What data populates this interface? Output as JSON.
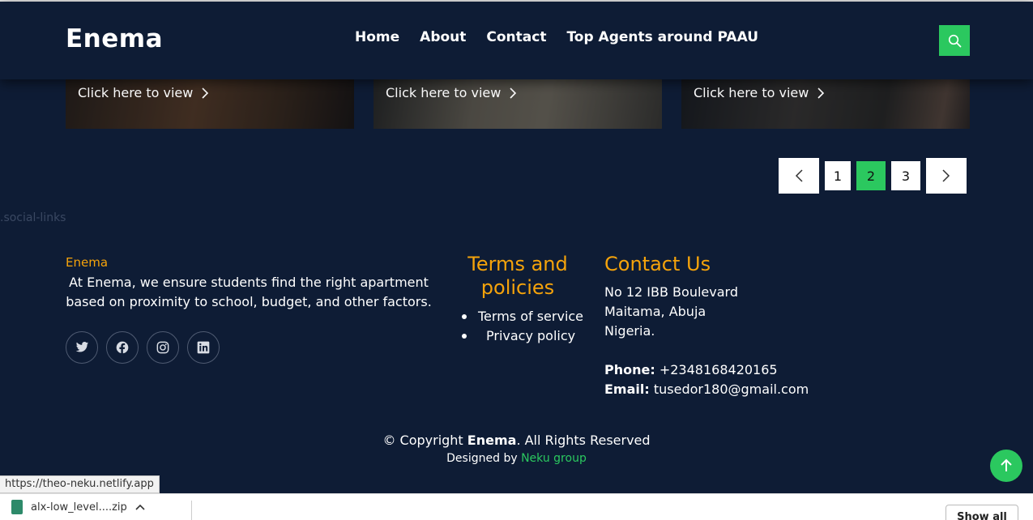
{
  "header": {
    "logo": "Enema",
    "nav": [
      "Home",
      "About",
      "Contact",
      "Top Agents around PAAU"
    ],
    "search_icon": "search-icon"
  },
  "cards": [
    {
      "cta": "Click here to view"
    },
    {
      "cta": "Click here to view"
    },
    {
      "cta": "Click here to view"
    }
  ],
  "pagination": {
    "pages": [
      "1",
      "2",
      "3"
    ],
    "active": "2"
  },
  "ghost_text": ".social-links",
  "footer": {
    "about_title": "Enema",
    "about_text": "At Enema, we ensure students find the right apartment based on proximity to school, budget, and other factors.",
    "socials": [
      "twitter-icon",
      "facebook-icon",
      "instagram-icon",
      "linkedin-icon"
    ],
    "terms_title": "Terms and policies",
    "terms_links": [
      "Terms of service",
      "Privacy policy"
    ],
    "contact_title": "Contact Us",
    "address": [
      "No 12 IBB Boulevard",
      "Maitama, Abuja",
      "Nigeria."
    ],
    "phone_label": "Phone:",
    "phone": "+2348168420165",
    "email_label": "Email:",
    "email": "tusedor180@gmail.com",
    "copyright_prefix": "© Copyright ",
    "copyright_brand": "Enema",
    "copyright_suffix": ". All Rights Reserved",
    "designed_by": "Designed by ",
    "designer": "Neku group"
  },
  "browser": {
    "status_url": "https://theo-neku.netlify.app",
    "download_name": "alx-low_level....zip",
    "show_all": "Show all"
  },
  "colors": {
    "accent": "#2bc85f",
    "heading": "#f5a30b",
    "background": "#0e1c35"
  }
}
